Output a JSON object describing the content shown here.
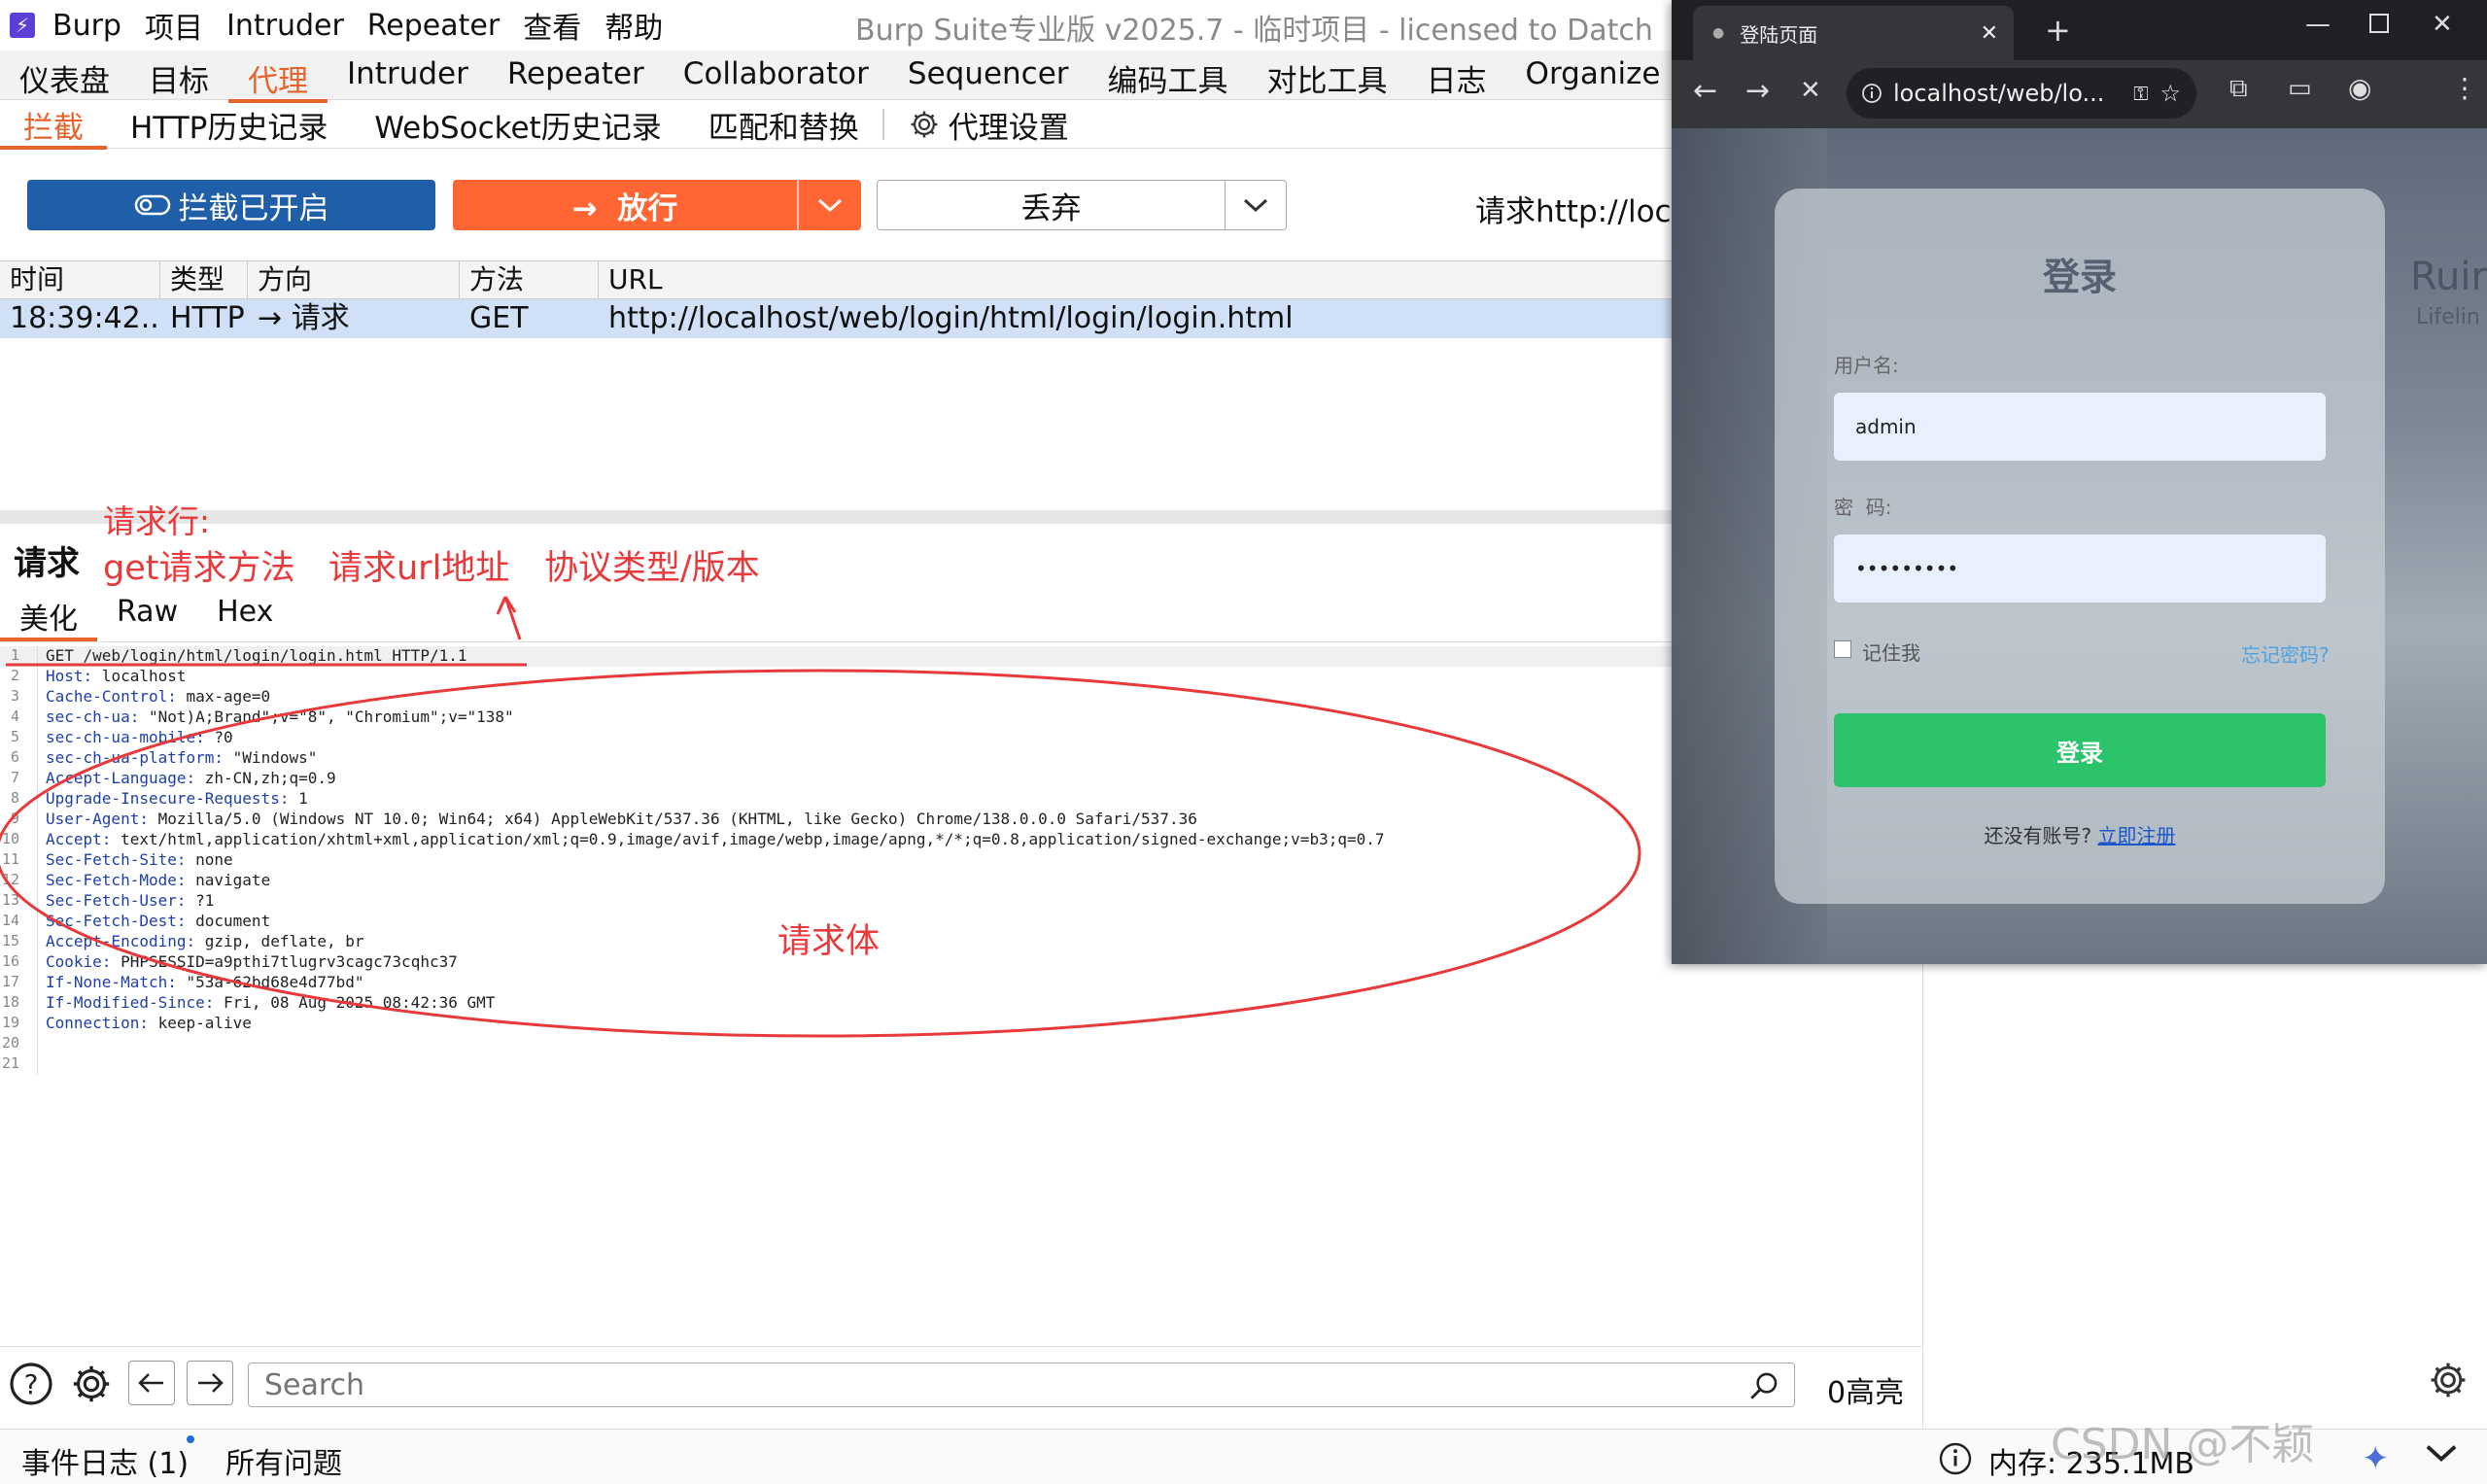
{
  "burp": {
    "menu": [
      "Burp",
      "项目",
      "Intruder",
      "Repeater",
      "查看",
      "帮助"
    ],
    "window_title": "Burp Suite专业版  v2025.7 - 临时项目 - licensed to Datch",
    "tabs": [
      "仪表盘",
      "目标",
      "代理",
      "Intruder",
      "Repeater",
      "Collaborator",
      "Sequencer",
      "编码工具",
      "对比工具",
      "日志",
      "Organize"
    ],
    "active_tab": "代理",
    "subtabs": [
      "拦截",
      "HTTP历史记录",
      "WebSocket历史记录",
      "匹配和替换",
      "代理设置"
    ],
    "toolbar": {
      "intercept_label": "拦截已开启",
      "forward_label": "放行",
      "drop_label": "丢弃",
      "request_info": "请求http://localhost"
    },
    "table": {
      "headers": [
        "时间",
        "类型",
        "方向",
        "方法",
        "URL"
      ],
      "row": {
        "time": "18:39:42...",
        "type": "HTTP",
        "direction": "请求",
        "method": "GET",
        "url": "http://localhost/web/login/html/login/login.html"
      }
    },
    "request_title": "请求",
    "view_tabs": [
      "美化",
      "Raw",
      "Hex"
    ],
    "request_lines": [
      {
        "k": "GET /web/login/html/login/login.html HTTP/1.1",
        "v": ""
      },
      {
        "k": "Host:",
        "v": " localhost"
      },
      {
        "k": "Cache-Control:",
        "v": " max-age=0"
      },
      {
        "k": "sec-ch-ua:",
        "v": " \"Not)A;Brand\";v=\"8\", \"Chromium\";v=\"138\""
      },
      {
        "k": "sec-ch-ua-mobile:",
        "v": " ?0"
      },
      {
        "k": "sec-ch-ua-platform:",
        "v": " \"Windows\""
      },
      {
        "k": "Accept-Language:",
        "v": " zh-CN,zh;q=0.9"
      },
      {
        "k": "Upgrade-Insecure-Requests:",
        "v": " 1"
      },
      {
        "k": "User-Agent:",
        "v": " Mozilla/5.0 (Windows NT 10.0; Win64; x64) AppleWebKit/537.36 (KHTML, like Gecko) Chrome/138.0.0.0 Safari/537.36"
      },
      {
        "k": "Accept:",
        "v": " text/html,application/xhtml+xml,application/xml;q=0.9,image/avif,image/webp,image/apng,*/*;q=0.8,application/signed-exchange;v=b3;q=0.7"
      },
      {
        "k": "Sec-Fetch-Site:",
        "v": " none"
      },
      {
        "k": "Sec-Fetch-Mode:",
        "v": " navigate"
      },
      {
        "k": "Sec-Fetch-User:",
        "v": " ?1"
      },
      {
        "k": "Sec-Fetch-Dest:",
        "v": " document"
      },
      {
        "k": "Accept-Encoding:",
        "v": " gzip, deflate, br"
      },
      {
        "k": "Cookie:",
        "v": " PHPSESSID=a9pthi7tlugrv3cagc73cqhc37"
      },
      {
        "k": "If-None-Match:",
        "v": " \"53a-62bd68e4d77bd\""
      },
      {
        "k": "If-Modified-Since:",
        "v": " Fri, 08 Aug 2025 08:42:36 GMT"
      },
      {
        "k": "Connection:",
        "v": " keep-alive"
      },
      {
        "k": "",
        "v": ""
      },
      {
        "k": "",
        "v": ""
      }
    ],
    "annotations": {
      "line_label": "请求行:",
      "method": "get请求方法",
      "url": "请求url地址",
      "protocol": "协议类型/版本",
      "body": "请求体"
    },
    "search_placeholder": "Search",
    "highlights": "0高亮",
    "status": {
      "event_log": "事件日志 (1)",
      "issues": "所有问题",
      "memory": "内存: 235.1MB"
    }
  },
  "browser": {
    "tab_title": "登陆页面",
    "url": "localhost/web/lo...",
    "login": {
      "title": "登录",
      "username_label": "用户名:",
      "username_value": "admin",
      "password_label": "密  码:",
      "password_value": "•••••••••",
      "remember_label": "记住我",
      "forgot_label": "忘记密码?",
      "submit_label": "登录",
      "register_prompt": "还没有账号?",
      "register_link": "立即注册"
    },
    "bg_text": [
      "Ruir",
      "Lifelin"
    ]
  },
  "watermark": "CSDN @不颖",
  "colors": {
    "accent": "#e8622c",
    "intercept": "#1f5fa8",
    "forward": "#ff6633",
    "annotation": "#e8393b",
    "login_button": "#2bc46a"
  }
}
